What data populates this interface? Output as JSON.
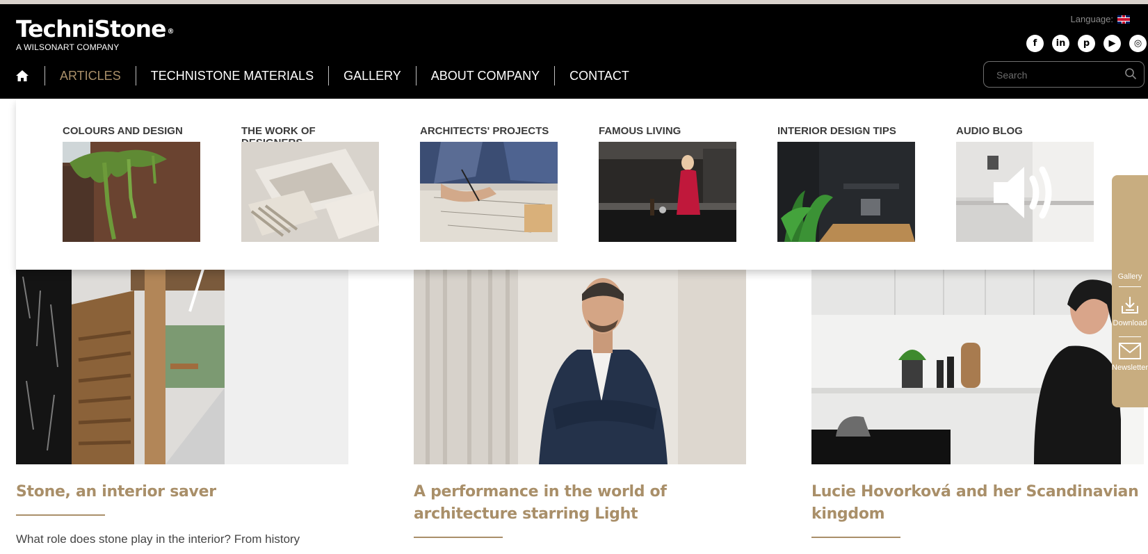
{
  "header": {
    "logo_text": "TechniStone",
    "logo_reg": "®",
    "logo_sub": "A WILSONART COMPANY",
    "language_label": "Language:",
    "socials": [
      "f",
      "in",
      "p",
      "▶",
      "◎"
    ],
    "search_placeholder": "Search"
  },
  "nav": {
    "items": [
      {
        "label": "ARTICLES",
        "active": true
      },
      {
        "label": "TECHNISTONE MATERIALS",
        "active": false
      },
      {
        "label": "GALLERY",
        "active": false
      },
      {
        "label": "ABOUT COMPANY",
        "active": false
      },
      {
        "label": "CONTACT",
        "active": false
      }
    ]
  },
  "dropdown": {
    "categories": [
      {
        "title": "COLOURS AND DESIGN"
      },
      {
        "title": "THE WORK OF DESIGNERS"
      },
      {
        "title": "ARCHITECTS' PROJECTS"
      },
      {
        "title": "FAMOUS LIVING"
      },
      {
        "title": "INTERIOR DESIGN TIPS"
      },
      {
        "title": "AUDIO BLOG"
      }
    ]
  },
  "articles": [
    {
      "title": "Stone, an interior saver",
      "text": "What role does stone play in the interior? From history"
    },
    {
      "title": "A performance in the world of architecture starring Light",
      "text": ""
    },
    {
      "title": "Lucie Hovorková and her Scandinavian kingdom",
      "text": ""
    }
  ],
  "sidebar": {
    "items": [
      {
        "label": "Gallery"
      },
      {
        "label": "Download"
      },
      {
        "label": "Newsletter"
      }
    ]
  },
  "colors": {
    "accent": "#a98f69",
    "header_bg": "#000000",
    "sidebar_bg": "#c8ad80"
  }
}
